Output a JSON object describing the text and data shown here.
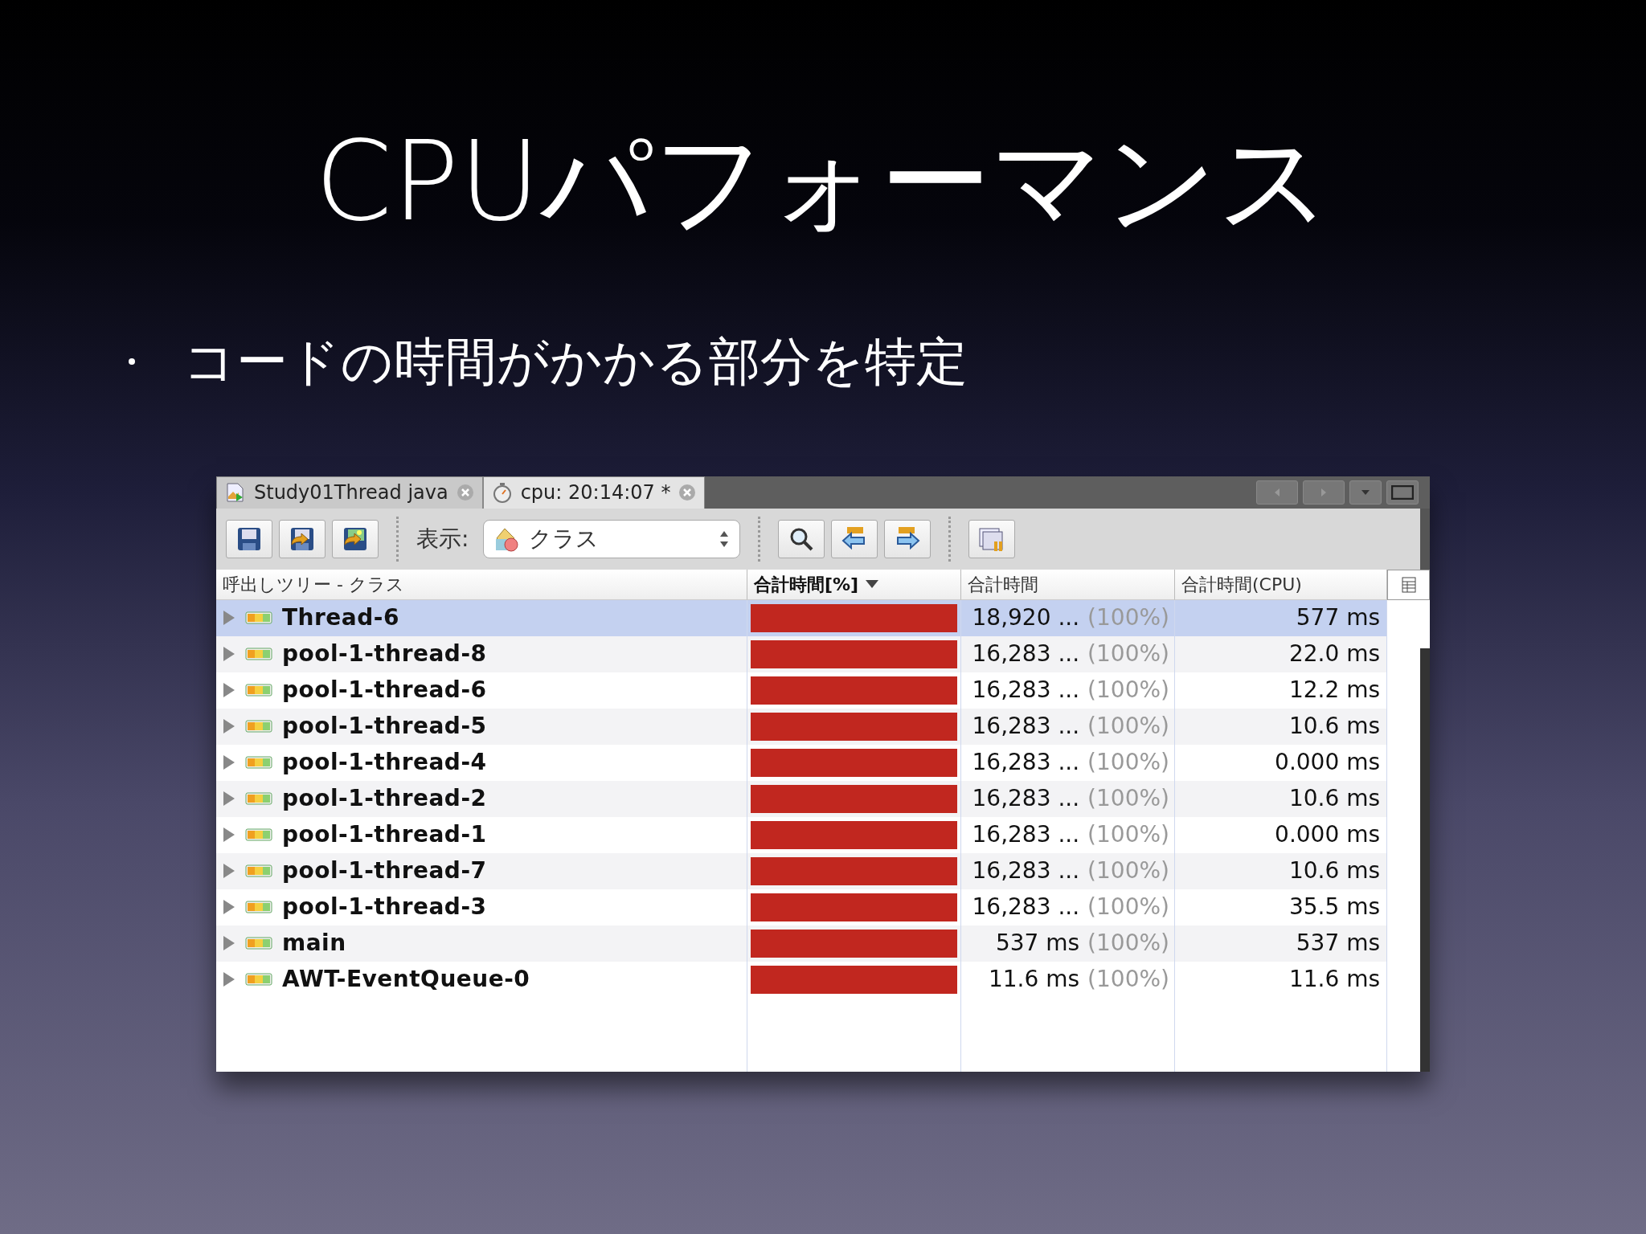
{
  "slide": {
    "title": "CPUパフォーマンス",
    "bullets": [
      "コードの時間がかかる部分を特定"
    ]
  },
  "window": {
    "tabs": [
      {
        "label": "Study01Thread java",
        "selected": false
      },
      {
        "label": "cpu: 20:14:07 *",
        "selected": true
      }
    ],
    "toolbar": {
      "view_label": "表示:",
      "view_value": "クラス"
    },
    "table": {
      "columns": [
        {
          "label": "呼出しツリー - クラス",
          "sorted": false
        },
        {
          "label": "合計時間[%]",
          "sorted": true
        },
        {
          "label": "合計時間",
          "sorted": false
        },
        {
          "label": "合計時間(CPU)",
          "sorted": false
        }
      ],
      "rows": [
        {
          "name": "Thread-6",
          "selected": true,
          "level": 1,
          "total": "18,920 ...",
          "percent": "(100%)",
          "cpu": "577 ms"
        },
        {
          "name": "pool-1-thread-8",
          "selected": false,
          "level": 1,
          "total": "16,283 ...",
          "percent": "(100%)",
          "cpu": "22.0 ms"
        },
        {
          "name": "pool-1-thread-6",
          "selected": false,
          "level": 1,
          "total": "16,283 ...",
          "percent": "(100%)",
          "cpu": "12.2 ms"
        },
        {
          "name": "pool-1-thread-5",
          "selected": false,
          "level": 1,
          "total": "16,283 ...",
          "percent": "(100%)",
          "cpu": "10.6 ms"
        },
        {
          "name": "pool-1-thread-4",
          "selected": false,
          "level": 1,
          "total": "16,283 ...",
          "percent": "(100%)",
          "cpu": "0.000 ms"
        },
        {
          "name": "pool-1-thread-2",
          "selected": false,
          "level": 1,
          "total": "16,283 ...",
          "percent": "(100%)",
          "cpu": "10.6 ms"
        },
        {
          "name": "pool-1-thread-1",
          "selected": false,
          "level": 1,
          "total": "16,283 ...",
          "percent": "(100%)",
          "cpu": "0.000 ms"
        },
        {
          "name": "pool-1-thread-7",
          "selected": false,
          "level": 1,
          "total": "16,283 ...",
          "percent": "(100%)",
          "cpu": "10.6 ms"
        },
        {
          "name": "pool-1-thread-3",
          "selected": false,
          "level": 1,
          "total": "16,283 ...",
          "percent": "(100%)",
          "cpu": "35.5 ms"
        },
        {
          "name": "main",
          "selected": false,
          "level": 1,
          "total": "537 ms",
          "percent": "(100%)",
          "cpu": "537 ms"
        },
        {
          "name": "AWT-EventQueue-0",
          "selected": false,
          "level": 1,
          "total": "11.6 ms",
          "percent": "(100%)",
          "cpu": "11.6 ms"
        }
      ]
    }
  }
}
